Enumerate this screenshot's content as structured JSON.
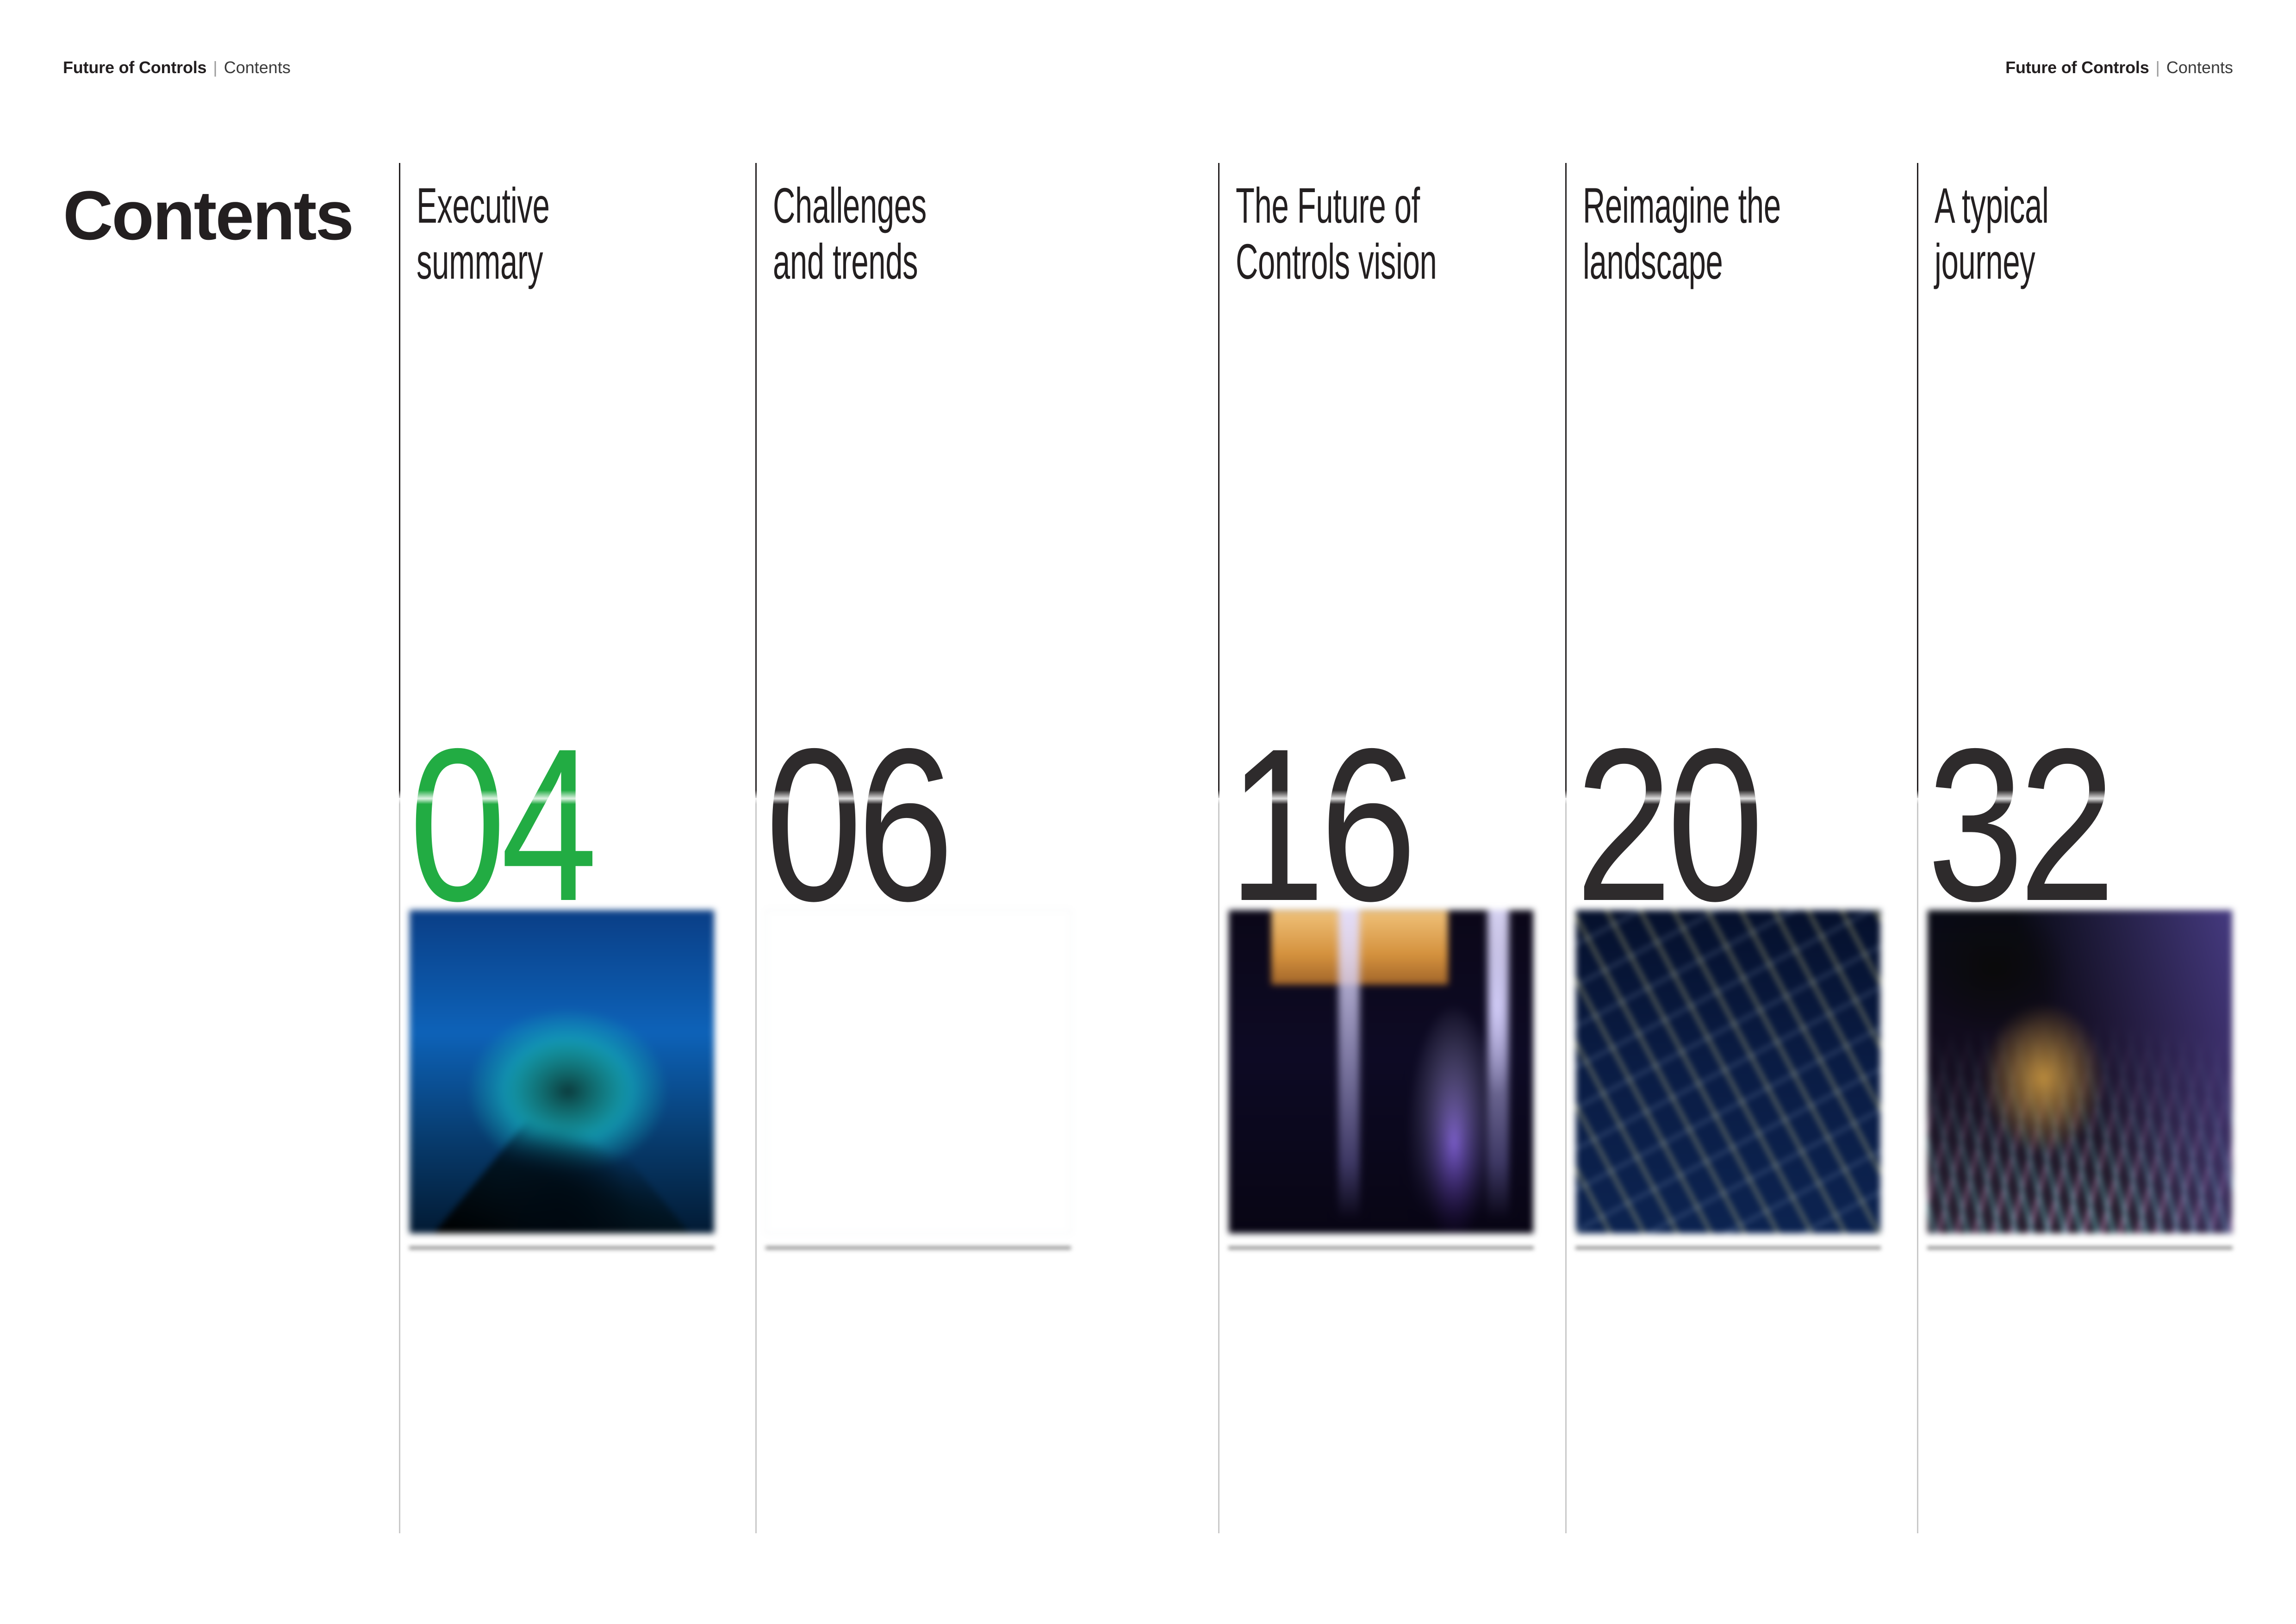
{
  "header": {
    "document_title": "Future of Controls",
    "separator": "|",
    "section": "Contents"
  },
  "page_title": "Contents",
  "accent_color": "#22ac43",
  "text_color": "#231f20",
  "columns": [
    {
      "heading": "Executive\nsummary",
      "page_number": "04",
      "number_is_accent": true,
      "thumbnail": "blue-tunnel-thumbnail",
      "caption": ""
    },
    {
      "heading": "Challenges\nand trends",
      "page_number": "06",
      "number_is_accent": false,
      "thumbnail": "neon-crowd-thumbnail",
      "caption": ""
    },
    {
      "heading": "The Future of\nControls vision",
      "page_number": "16",
      "number_is_accent": false,
      "thumbnail": "stage-light-thumbnail",
      "caption": ""
    },
    {
      "heading": "Reimagine the\nlandscape",
      "page_number": "20",
      "number_is_accent": false,
      "thumbnail": "city-grid-thumbnail",
      "caption": ""
    },
    {
      "heading": "A typical\njourney",
      "page_number": "32",
      "number_is_accent": false,
      "thumbnail": "light-trails-thumbnail",
      "caption": ""
    }
  ],
  "folio": {
    "left": "",
    "right": ""
  }
}
